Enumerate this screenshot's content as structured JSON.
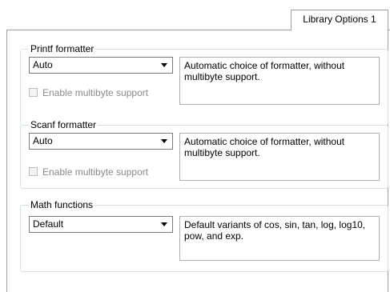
{
  "tabs": [
    {
      "label": "Library Options 1",
      "selected": true
    }
  ],
  "printf": {
    "title": "Printf formatter",
    "selected": "Auto",
    "description": "Automatic choice of formatter, without multibyte support.",
    "multibyte_label": "Enable multibyte support",
    "multibyte_checked": false,
    "multibyte_enabled": false
  },
  "scanf": {
    "title": "Scanf formatter",
    "selected": "Auto",
    "description": "Automatic choice of formatter, without multibyte support.",
    "multibyte_label": "Enable multibyte support",
    "multibyte_checked": false,
    "multibyte_enabled": false
  },
  "math": {
    "title": "Math functions",
    "selected": "Default",
    "description": "Default variants of cos, sin, tan, log, log10, pow, and exp."
  },
  "colors": {
    "border": "#a0a0a0",
    "group_border": "#d5dfe5",
    "disabled_text": "#8a8a8a"
  },
  "icons": {
    "dropdown": "chevron-down-icon"
  }
}
